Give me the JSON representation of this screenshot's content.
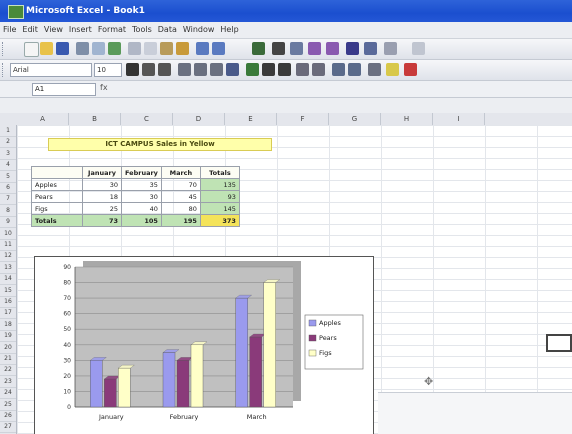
{
  "window": {
    "title": "Microsoft Excel - Book1"
  },
  "menu": [
    "File",
    "Edit",
    "View",
    "Insert",
    "Format",
    "Tools",
    "Data",
    "Window",
    "Help"
  ],
  "formula_bar": {
    "name_box": "A1",
    "fx_label": "fx"
  },
  "font": {
    "name": "Arial",
    "size": "10"
  },
  "columns": [
    "A",
    "B",
    "C",
    "D",
    "E",
    "F",
    "G",
    "H",
    "I"
  ],
  "rows": [
    "1",
    "2",
    "3",
    "4",
    "5",
    "6",
    "7",
    "8",
    "9",
    "10",
    "11",
    "12",
    "13",
    "14",
    "15",
    "16",
    "17",
    "18",
    "19",
    "20",
    "21",
    "22",
    "23",
    "24",
    "25",
    "26",
    "27"
  ],
  "sheet": {
    "banner": "ICT CAMPUS  Sales in Yellow",
    "headers": [
      "",
      "January",
      "February",
      "March",
      "Totals"
    ],
    "rows": [
      {
        "label": "Apples",
        "values": [
          "30",
          "35",
          "70"
        ],
        "total": "135"
      },
      {
        "label": "Pears",
        "values": [
          "18",
          "30",
          "45"
        ],
        "total": "93"
      },
      {
        "label": "Figs",
        "values": [
          "25",
          "40",
          "80"
        ],
        "total": "145"
      }
    ],
    "totals": {
      "label": "Totals",
      "values": [
        "73",
        "105",
        "195"
      ],
      "grand": "373"
    }
  },
  "chart_data": {
    "type": "bar",
    "categories": [
      "January",
      "February",
      "March"
    ],
    "series": [
      {
        "name": "Apples",
        "values": [
          30,
          35,
          70
        ],
        "color": "#9a9aee"
      },
      {
        "name": "Pears",
        "values": [
          18,
          30,
          45
        ],
        "color": "#8a3a7a"
      },
      {
        "name": "Figs",
        "values": [
          25,
          40,
          80
        ],
        "color": "#ffffc8"
      }
    ],
    "yticks": [
      "0",
      "10",
      "20",
      "30",
      "40",
      "50",
      "60",
      "70",
      "80",
      "90"
    ],
    "ylim": [
      0,
      90
    ],
    "plot_background": "#c0c0c0",
    "legend_position": "right"
  },
  "colors": {
    "titlebar": "#1b4fcf",
    "banner": "#ffffaa",
    "totals": "#bfe3b4",
    "grand_total": "#f4e35a"
  }
}
